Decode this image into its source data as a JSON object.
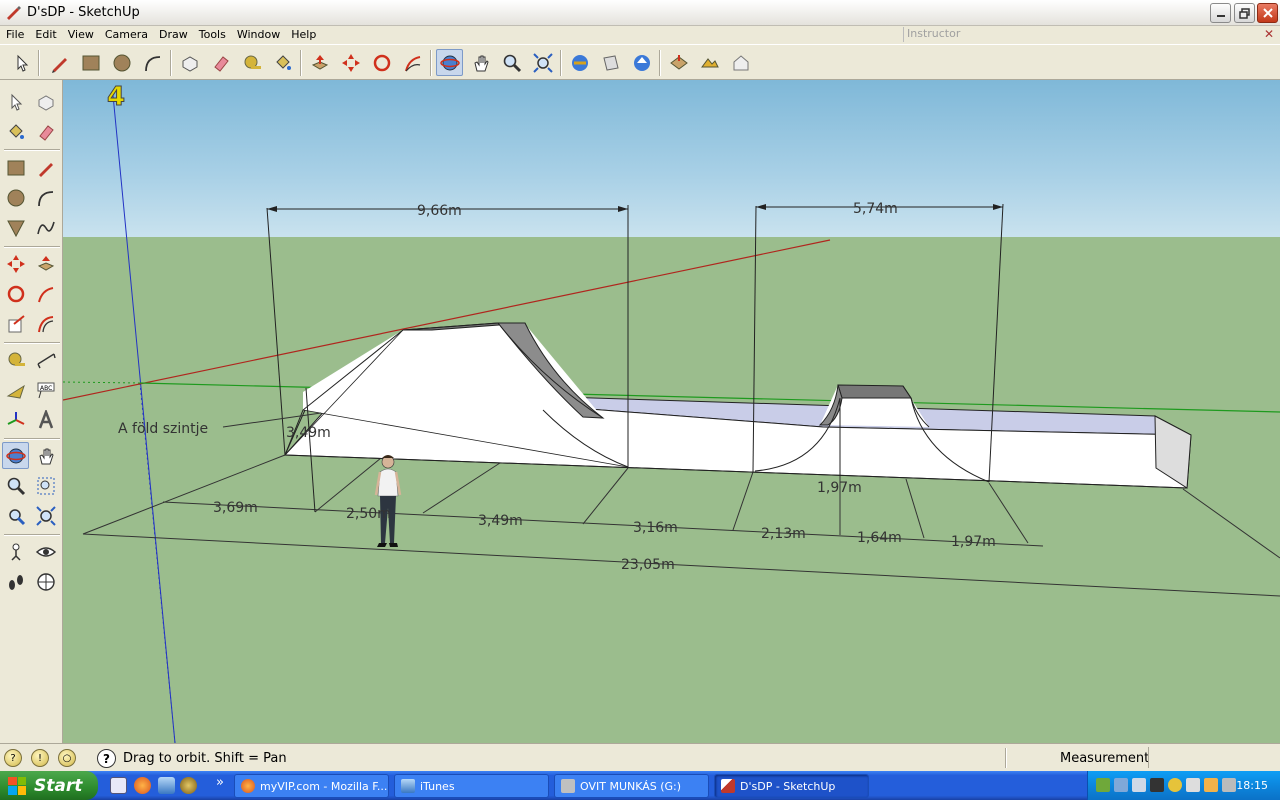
{
  "window": {
    "title": "D'sDP - SketchUp",
    "controls": [
      "minimize",
      "restore",
      "close"
    ]
  },
  "menubar": {
    "items": [
      "File",
      "Edit",
      "View",
      "Camera",
      "Draw",
      "Tools",
      "Window",
      "Help"
    ]
  },
  "instructor": {
    "title": "Instructor"
  },
  "toolbar": {
    "tools": [
      "select-icon",
      "pencil-icon",
      "rectangle-icon",
      "circle-icon",
      "arc-icon",
      "make-component-icon",
      "eraser-icon",
      "tape-measure-icon",
      "paint-bucket-icon",
      "push-pull-icon",
      "move-icon",
      "rotate-icon",
      "follow-me-icon",
      "orbit-icon",
      "pan-icon",
      "zoom-icon",
      "zoom-extents-icon",
      "get-models-icon",
      "share-model-icon",
      "share-component-icon",
      "add-location-icon",
      "toggle-terrain-icon",
      "photo-textures-icon"
    ],
    "active": "orbit-icon"
  },
  "palette": {
    "tools": [
      "select",
      "make-component",
      "paint-bucket",
      "eraser",
      "rectangle",
      "line",
      "circle",
      "arc",
      "polygon",
      "freehand",
      "move",
      "push-pull",
      "rotate",
      "follow-me",
      "scale",
      "offset",
      "tape-measure",
      "dimension",
      "protractor",
      "text",
      "axes",
      "3d-text",
      "orbit",
      "pan",
      "zoom",
      "zoom-window",
      "previous",
      "zoom-extents",
      "position-camera",
      "look-around",
      "walk",
      "section-plane"
    ],
    "active": "orbit"
  },
  "scene": {
    "axis_marker": "4",
    "ground_label": "A föld szintje",
    "dimensions": {
      "top_left": "9,66m",
      "top_right": "5,74m",
      "height": "3,49m",
      "small_height": "1,97m",
      "bottom_segments": [
        "3,69m",
        "2,50m",
        "3,49m",
        "3,16m",
        "2,13m",
        "1,64m",
        "1,97m"
      ],
      "total": "23,05m"
    },
    "colors": {
      "sky": "#a8d0e6",
      "ground": "#9bbd8d",
      "red_axis": "#b0261e",
      "green_axis": "#1e9a1e",
      "blue_axis": "#2333c4"
    }
  },
  "statusbar": {
    "hint": "Drag to orbit.  Shift = Pan",
    "measurements_label": "Measurements",
    "measurements_value": ""
  },
  "taskbar": {
    "start_label": "Start",
    "tasks": [
      "myVIP.com - Mozilla F...",
      "iTunes",
      "OVIT MUNKÁS (G:)",
      "D'sDP - SketchUp"
    ],
    "active_task": "D'sDP - SketchUp",
    "overflow": "»",
    "clock": "18:15"
  }
}
